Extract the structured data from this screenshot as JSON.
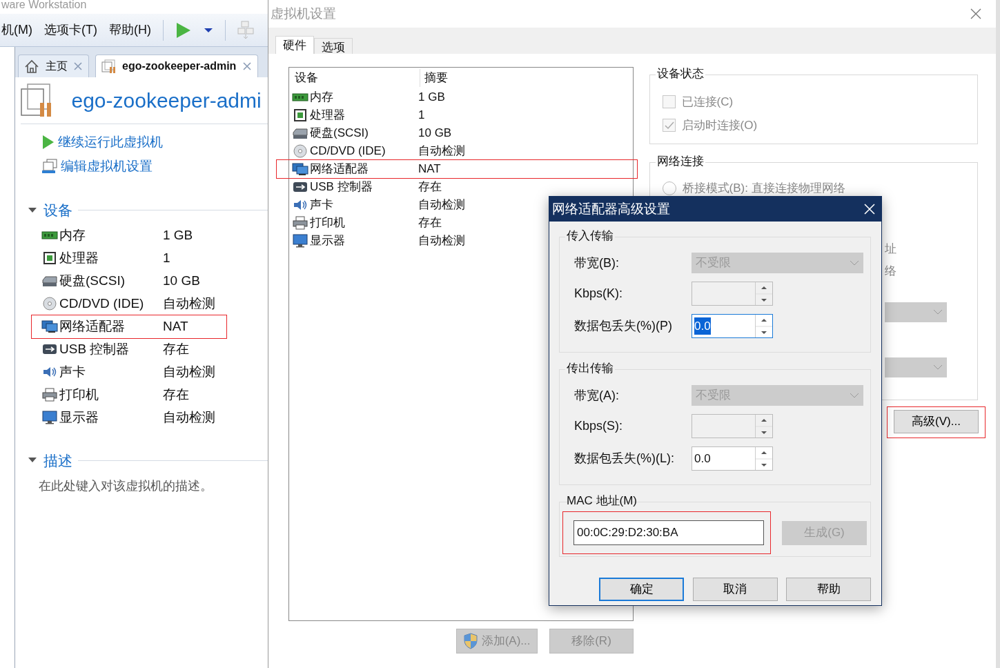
{
  "workstation": {
    "title": "ware Workstation",
    "menu": [
      {
        "label": "机(M)"
      },
      {
        "label": "选项卡(T)"
      },
      {
        "label": "帮助(H)"
      }
    ],
    "tabs": [
      {
        "label": "主页",
        "kind": "home",
        "selected": false
      },
      {
        "label": "ego-zookeeper-admin",
        "kind": "vm",
        "selected": true
      }
    ],
    "vm_title": "ego-zookeeper-admi",
    "actions": [
      {
        "label": "继续运行此虚拟机",
        "kind": "play"
      },
      {
        "label": "编辑虚拟机设置",
        "kind": "edit"
      }
    ],
    "devices_section": {
      "title": "设备",
      "expanded": true,
      "items": [
        {
          "name": "内存",
          "summary": "1 GB",
          "kind": "memory",
          "annotated": false
        },
        {
          "name": "处理器",
          "summary": "1",
          "kind": "cpu",
          "annotated": false
        },
        {
          "name": "硬盘(SCSI)",
          "summary": "10 GB",
          "kind": "disk",
          "annotated": false
        },
        {
          "name": "CD/DVD (IDE)",
          "summary": "自动检测",
          "kind": "cd",
          "annotated": false
        },
        {
          "name": "网络适配器",
          "summary": "NAT",
          "kind": "network",
          "annotated": true
        },
        {
          "name": "USB 控制器",
          "summary": "存在",
          "kind": "usb",
          "annotated": false
        },
        {
          "name": "声卡",
          "summary": "自动检测",
          "kind": "sound",
          "annotated": false
        },
        {
          "name": "打印机",
          "summary": "存在",
          "kind": "printer",
          "annotated": false
        },
        {
          "name": "显示器",
          "summary": "自动检测",
          "kind": "display",
          "annotated": false
        }
      ]
    },
    "description_section": {
      "title": "描述",
      "expanded": true,
      "text": "在此处键入对该虚拟机的描述。"
    }
  },
  "settings_dialog": {
    "title": "虚拟机设置",
    "tabs": [
      {
        "label": "硬件",
        "selected": true
      },
      {
        "label": "选项",
        "selected": false
      }
    ],
    "columns": [
      "设备",
      "摘要"
    ],
    "devices": [
      {
        "name": "内存",
        "summary": "1 GB",
        "kind": "memory",
        "selected": false,
        "annotated": false
      },
      {
        "name": "处理器",
        "summary": "1",
        "kind": "cpu",
        "selected": false,
        "annotated": false
      },
      {
        "name": "硬盘(SCSI)",
        "summary": "10 GB",
        "kind": "disk",
        "selected": false,
        "annotated": false
      },
      {
        "name": "CD/DVD (IDE)",
        "summary": "自动检测",
        "kind": "cd",
        "selected": false,
        "annotated": false
      },
      {
        "name": "网络适配器",
        "summary": "NAT",
        "kind": "network",
        "selected": false,
        "annotated": true
      },
      {
        "name": "USB 控制器",
        "summary": "存在",
        "kind": "usb",
        "selected": false,
        "annotated": false
      },
      {
        "name": "声卡",
        "summary": "自动检测",
        "kind": "sound",
        "selected": false,
        "annotated": false
      },
      {
        "name": "打印机",
        "summary": "存在",
        "kind": "printer",
        "selected": false,
        "annotated": false
      },
      {
        "name": "显示器",
        "summary": "自动检测",
        "kind": "display",
        "selected": false,
        "annotated": false
      }
    ],
    "buttons": [
      {
        "label": "添加(A)...",
        "kind": "shield",
        "disabled": true
      },
      {
        "label": "移除(R)",
        "kind": "plain",
        "disabled": true
      }
    ],
    "device_status": {
      "title": "设备状态",
      "checkboxes": [
        {
          "label": "已连接(C)",
          "checked": false,
          "disabled": true
        },
        {
          "label": "启动时连接(O)",
          "checked": true,
          "disabled": true
        }
      ]
    },
    "network_connection": {
      "title": "网络连接",
      "options": [
        {
          "label": "桥接模式(B): 直接连接物理网络",
          "selected": false
        }
      ],
      "fragments": [
        "址",
        "络"
      ]
    },
    "advanced_button": {
      "label": "高级(V)...",
      "annotated": true
    }
  },
  "advanced_dialog": {
    "title": "网络适配器高级设置",
    "groups": [
      {
        "title": "传入传输",
        "fields": [
          {
            "label": "带宽(B):",
            "kind": "dropdown",
            "value": "不受限",
            "disabled": true
          },
          {
            "label": "Kbps(K):",
            "kind": "spinner",
            "disabled": true
          },
          {
            "label": "数据包丢失(%)(P)",
            "kind": "spinner",
            "value": "0.0",
            "focused": true,
            "disabled": false
          }
        ]
      },
      {
        "title": "传出传输",
        "fields": [
          {
            "label": "带宽(A):",
            "kind": "dropdown",
            "value": "不受限",
            "disabled": true
          },
          {
            "label": "Kbps(S):",
            "kind": "spinner",
            "disabled": true
          },
          {
            "label": "数据包丢失(%)(L):",
            "kind": "spinner",
            "value": "0.0",
            "focused": false,
            "disabled": false
          }
        ]
      }
    ],
    "mac": {
      "title": "MAC 地址(M)",
      "value": "00:0C:29:D2:30:BA",
      "annotated": true,
      "button": {
        "label": "生成(G)",
        "disabled": true
      }
    },
    "buttons": [
      {
        "label": "确定",
        "default": true
      },
      {
        "label": "取消",
        "default": false
      },
      {
        "label": "帮助",
        "default": false
      }
    ]
  }
}
